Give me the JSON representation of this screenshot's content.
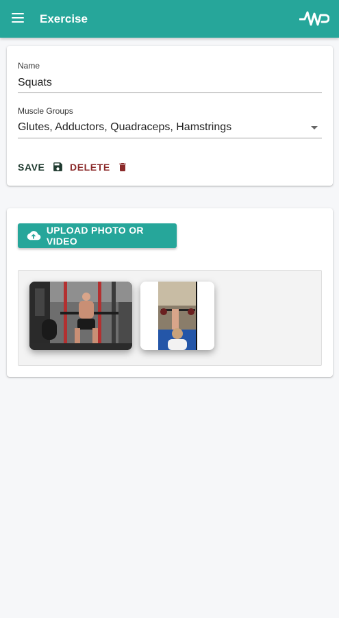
{
  "header": {
    "title": "Exercise",
    "menu_icon": "hamburger-menu-icon",
    "logo_icon": "wp-logo"
  },
  "form": {
    "name_label": "Name",
    "name_value": "Squats",
    "muscle_label": "Muscle Groups",
    "muscle_value": "Glutes, Adductors, Quadraceps, Hamstrings",
    "save_label": "SAVE",
    "delete_label": "DELETE"
  },
  "media": {
    "upload_label": "UPLOAD PHOTO OR VIDEO",
    "items": [
      {
        "kind": "photo",
        "subject": "man squatting with barbell in rack"
      },
      {
        "kind": "video",
        "subject": "gym scene, vertical video"
      }
    ]
  },
  "colors": {
    "primary": "#26a69a",
    "save": "#1f3a2f",
    "delete": "#8b2a2a",
    "background": "#f6f7f9"
  }
}
